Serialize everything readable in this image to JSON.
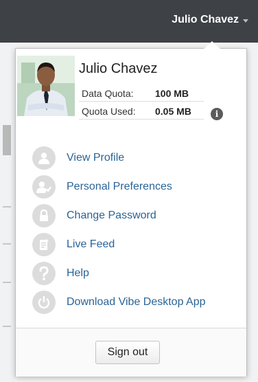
{
  "header": {
    "user_name": "Julio Chavez"
  },
  "profile": {
    "name": "Julio Chavez",
    "data_quota_label": "Data Quota:",
    "data_quota_value": "100 MB",
    "quota_used_label": "Quota Used:",
    "quota_used_value": "0.05 MB",
    "info_icon": "info-icon"
  },
  "menu": {
    "items": [
      {
        "label": "View Profile",
        "icon": "user-icon"
      },
      {
        "label": "Personal Preferences",
        "icon": "user-settings-icon"
      },
      {
        "label": "Change Password",
        "icon": "lock-icon"
      },
      {
        "label": "Live Feed",
        "icon": "feed-icon"
      },
      {
        "label": "Help",
        "icon": "help-icon"
      },
      {
        "label": "Download Vibe Desktop App",
        "icon": "power-icon"
      }
    ]
  },
  "footer": {
    "signout_label": "Sign out"
  },
  "colors": {
    "header_bg": "#3e4146",
    "link": "#2a6496",
    "icon_bg": "#dcdcdc"
  }
}
